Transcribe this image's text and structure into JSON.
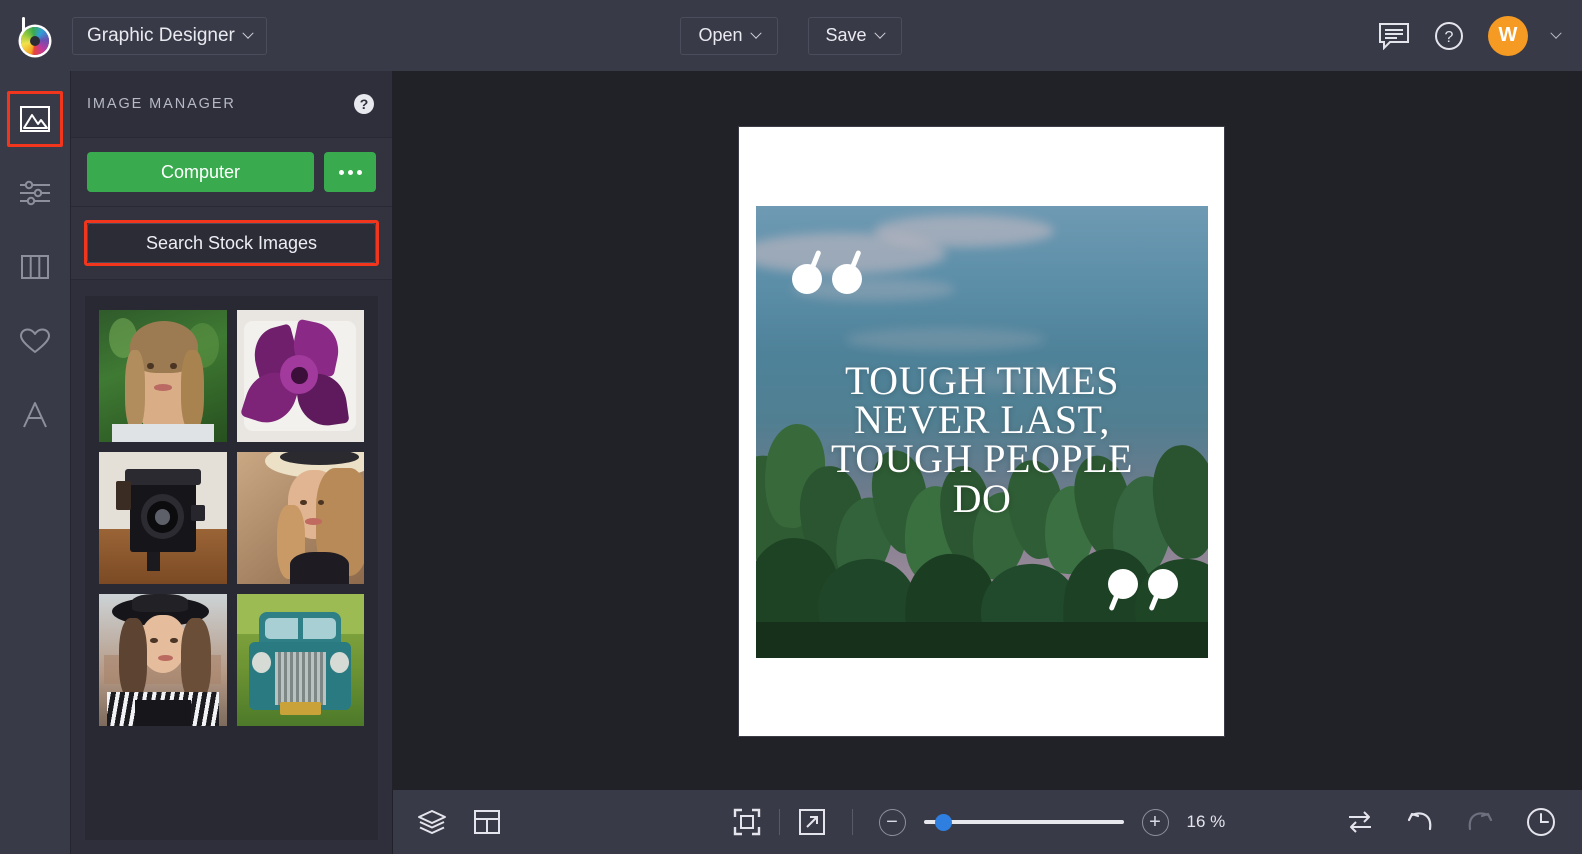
{
  "app": {
    "logo_name": "befunky-logo",
    "workspace_label": "Graphic Designer"
  },
  "topbar": {
    "open_label": "Open",
    "save_label": "Save",
    "feedback_icon": "comment-icon",
    "help_icon": "question-mark-icon",
    "avatar_initial": "W",
    "accent_orange": "#f59a23"
  },
  "rail": {
    "items": [
      {
        "name": "image-manager",
        "icon": "image-icon",
        "selected": true
      },
      {
        "name": "edit-adjustments",
        "icon": "sliders-icon",
        "selected": false
      },
      {
        "name": "templates",
        "icon": "columns-icon",
        "selected": false
      },
      {
        "name": "graphics",
        "icon": "heart-icon",
        "selected": false
      },
      {
        "name": "text",
        "icon": "letter-a-icon",
        "selected": false
      }
    ],
    "highlight_color": "#f1361d"
  },
  "panel": {
    "title": "IMAGE MANAGER",
    "help_icon": "question-mark-icon",
    "computer_label": "Computer",
    "more_icon": "ellipsis-icon",
    "search_label": "Search Stock Images",
    "search_highlight_color": "#f1361d",
    "green": "#3aaa4f",
    "thumbnails": [
      {
        "name": "portrait-woman-smiling-greenery"
      },
      {
        "name": "purple-flower-plate"
      },
      {
        "name": "vintage-camera-on-wood"
      },
      {
        "name": "woman-in-straw-hat"
      },
      {
        "name": "woman-in-black-hat"
      },
      {
        "name": "vintage-teal-truck"
      }
    ]
  },
  "canvas": {
    "design": {
      "quote_lines": [
        "TOUGH TIMES",
        "NEVER LAST,",
        "TOUGH PEOPLE",
        "DO"
      ],
      "open_quote_icon": "open-quote-mark",
      "close_quote_icon": "close-quote-mark",
      "photo_subject": "cactus-field-at-dusk"
    }
  },
  "bottombar": {
    "layers_icon": "layers-icon",
    "template_icon": "layout-icon",
    "fit_icon": "fit-to-screen-icon",
    "expand_icon": "fullscreen-arrow-icon",
    "zoom_out_label": "−",
    "zoom_in_label": "+",
    "zoom_level": "16 %",
    "zoom_slider_percent": 6,
    "swap_icon": "swap-arrows-icon",
    "undo_icon": "undo-arrow-icon",
    "redo_icon": "redo-arrow-icon",
    "history_icon": "clock-history-icon",
    "slider_accent": "#2f7fe0"
  }
}
